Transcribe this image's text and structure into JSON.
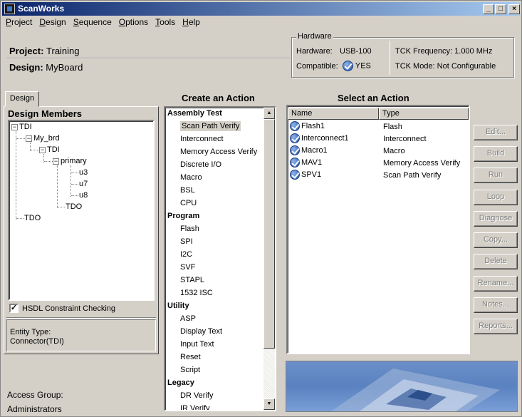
{
  "window": {
    "title": "ScanWorks",
    "minimize": "_",
    "maximize": "□",
    "close": "×"
  },
  "menu": [
    "Project",
    "Design",
    "Sequence",
    "Options",
    "Tools",
    "Help"
  ],
  "project": {
    "label": "Project:",
    "value": "Training"
  },
  "design": {
    "label": "Design:",
    "value": "MyBoard"
  },
  "hardware": {
    "group_title": "Hardware",
    "hardware_label": "Hardware:",
    "hardware_value": "USB-100",
    "compatible_label": "Compatible:",
    "compatible_value": "YES",
    "tck_frequency": "TCK Frequency: 1.000 MHz",
    "tck_mode": "TCK Mode: Not Configurable"
  },
  "left_panel": {
    "tab": "Design",
    "heading": "Design Members",
    "tree": {
      "root": "TDI",
      "board": "My_brd",
      "board_tdi": "TDI",
      "chain": "primary",
      "u3": "u3",
      "u7": "u7",
      "u8": "u8",
      "tdo_inner": "TDO",
      "tdo": "TDO",
      "expanded_symbol": "−"
    },
    "hsdl_checkbox": {
      "label": "HSDL Constraint Checking",
      "checked": true,
      "mark": "✓"
    },
    "entity_type_label": "Entity Type:",
    "entity_type_value": "Connector(TDI)"
  },
  "create_action": {
    "heading": "Create an Action",
    "categories": [
      {
        "name": "Assembly Test",
        "items": [
          "Scan Path Verify",
          "Interconnect",
          "Memory Access Verify",
          "Discrete I/O",
          "Macro",
          "BSL",
          "CPU"
        ]
      },
      {
        "name": "Program",
        "items": [
          "Flash",
          "SPI",
          "I2C",
          "SVF",
          "STAPL",
          "1532 ISC"
        ]
      },
      {
        "name": "Utility",
        "items": [
          "ASP",
          "Display Text",
          "Input Text",
          "Reset",
          "Script"
        ]
      },
      {
        "name": "Legacy",
        "items": [
          "DR Verify",
          "IR Verify"
        ]
      }
    ],
    "selected": "Scan Path Verify",
    "scroll_up": "▲",
    "scroll_down": "▼"
  },
  "select_action": {
    "heading": "Select an Action",
    "columns": [
      "Name",
      "Type"
    ],
    "rows": [
      {
        "name": "Flash1",
        "type": "Flash"
      },
      {
        "name": "Interconnect1",
        "type": "Interconnect"
      },
      {
        "name": "Macro1",
        "type": "Macro"
      },
      {
        "name": "MAV1",
        "type": "Memory Access Verify"
      },
      {
        "name": "SPV1",
        "type": "Scan Path Verify"
      }
    ]
  },
  "buttons": [
    "Edit...",
    "Build",
    "Run",
    "Loop",
    "Diagnose",
    "Copy...",
    "Delete",
    "Rename...",
    "Notes...",
    "Reports..."
  ],
  "access_group": {
    "label": "Access Group:",
    "value": "Administrators"
  },
  "colors": {
    "titlebar_start": "#0a246a",
    "titlebar_end": "#a6caf0",
    "face": "#d4d0c8",
    "check_blue": "#2453a8"
  }
}
